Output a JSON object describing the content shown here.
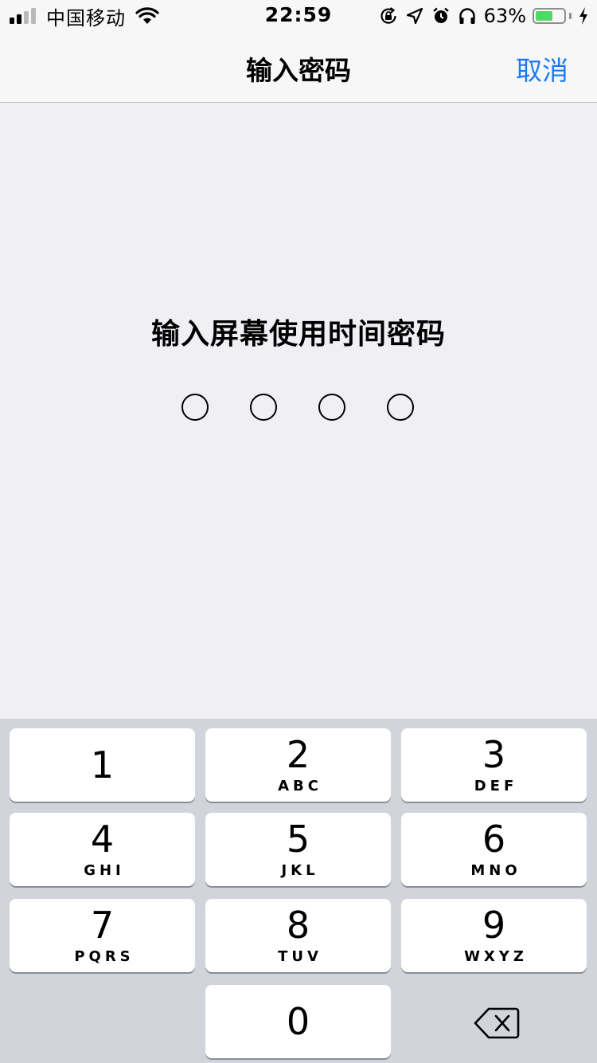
{
  "status_bar": {
    "carrier": "中国移动",
    "time": "22:59",
    "battery_percent": "63%",
    "battery_level": 0.63,
    "signal_bars_active": 2,
    "signal_bars_total": 4,
    "icons": [
      "signal-icon",
      "wifi-icon",
      "orientation-lock-icon",
      "location-icon",
      "alarm-icon",
      "headphones-icon",
      "battery-icon",
      "charging-bolt-icon"
    ]
  },
  "nav": {
    "title": "输入密码",
    "cancel_label": "取消",
    "accent_color": "#1a7bf0"
  },
  "prompt": {
    "title": "输入屏幕使用时间密码",
    "digit_count": 4,
    "entered_count": 0
  },
  "keypad": {
    "keys": [
      {
        "digit": "1",
        "letters": ""
      },
      {
        "digit": "2",
        "letters": "ABC"
      },
      {
        "digit": "3",
        "letters": "DEF"
      },
      {
        "digit": "4",
        "letters": "GHI"
      },
      {
        "digit": "5",
        "letters": "JKL"
      },
      {
        "digit": "6",
        "letters": "MNO"
      },
      {
        "digit": "7",
        "letters": "PQRS"
      },
      {
        "digit": "8",
        "letters": "TUV"
      },
      {
        "digit": "9",
        "letters": "WXYZ"
      },
      {
        "digit": "0",
        "letters": ""
      }
    ],
    "delete_icon": "delete-backspace-icon"
  }
}
